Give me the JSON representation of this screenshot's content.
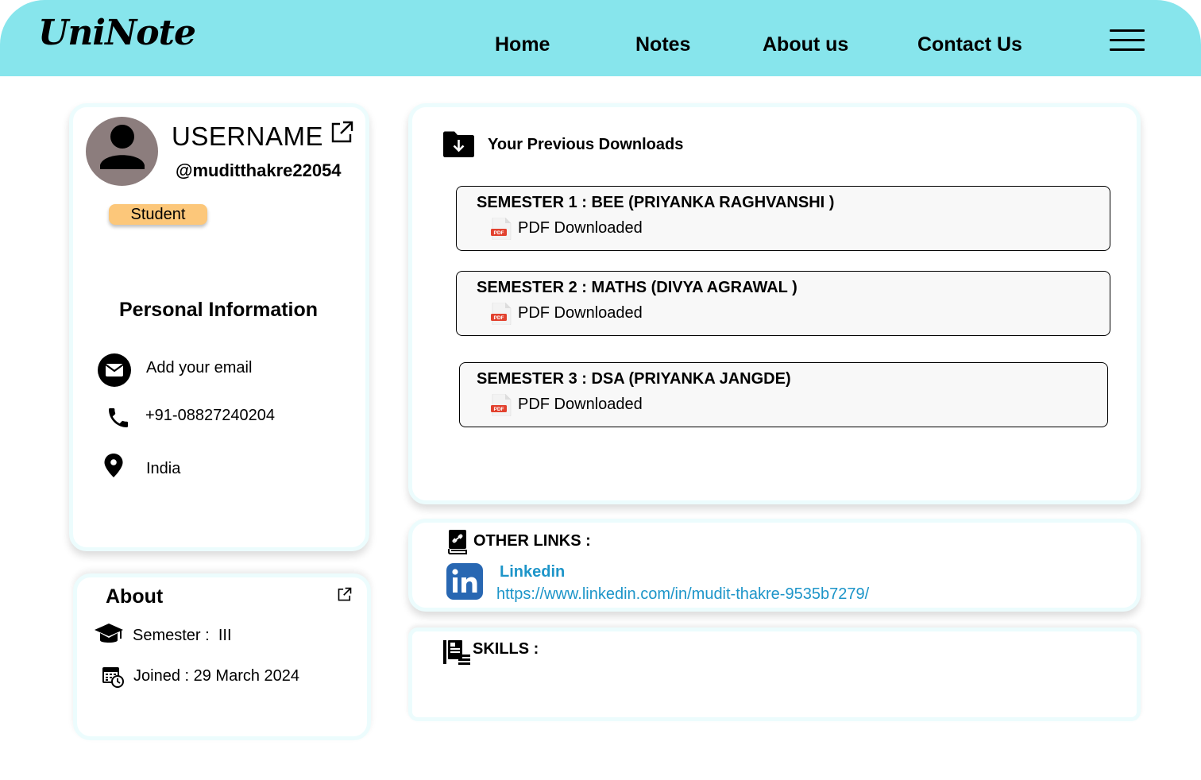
{
  "header": {
    "logo": "UniNote",
    "nav": [
      "Home",
      "Notes",
      "About us",
      "Contact Us"
    ]
  },
  "profile": {
    "username": "USERNAME",
    "handle": "@muditthakre22054",
    "role_badge": "Student",
    "personal_info_title": "Personal Information",
    "email_placeholder": "Add your email",
    "phone": "+91-08827240204",
    "location": "India"
  },
  "about": {
    "title": "About",
    "semester_label": "Semester :",
    "semester_value": "III",
    "joined": "Joined : 29 March 2024"
  },
  "downloads": {
    "title": "Your Previous Downloads",
    "items": [
      {
        "title": "SEMESTER 1 : BEE (PRIYANKA RAGHVANSHI )",
        "status": "PDF Downloaded"
      },
      {
        "title": "SEMESTER 2 : MATHS (DIVYA AGRAWAL )",
        "status": "PDF Downloaded"
      },
      {
        "title": "SEMESTER 3 : DSA (PRIYANKA JANGDE)",
        "status": "PDF Downloaded"
      }
    ],
    "pdf_icon_label": "PDF"
  },
  "links": {
    "title": "OTHER LINKS :",
    "linkedin_name": "Linkedin",
    "linkedin_url": "https://www.linkedin.com/in/mudit-thakre-9535b7279/"
  },
  "skills": {
    "title": "SKILLS :"
  },
  "colors": {
    "header_bg": "#87e5ec",
    "badge_bg": "#fcc77a",
    "link": "#1d95c9",
    "linkedin_brand": "#2867b2",
    "pdf_red": "#e2412e"
  }
}
